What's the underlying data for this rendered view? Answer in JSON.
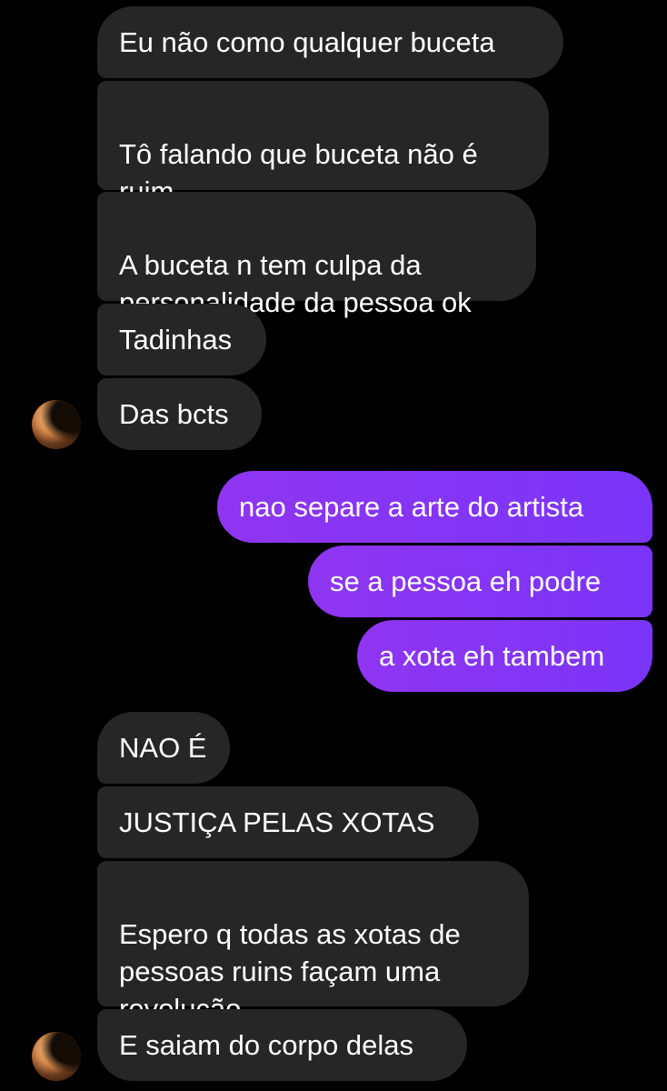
{
  "conversation": {
    "received_1": [
      "Eu não como qualquer buceta",
      "Tô falando que buceta não é\nruim",
      "A buceta n tem culpa da\npersonalidade da pessoa ok",
      "Tadinhas",
      "Das bcts"
    ],
    "sent": [
      "nao separe a arte do artista",
      "se a pessoa eh podre",
      "a xota eh tambem"
    ],
    "received_2": [
      "NAO É",
      "JUSTIÇA PELAS XOTAS",
      "Espero q todas as xotas de\npessoas ruins façam uma\nrevolução",
      "E saiam do corpo delas"
    ]
  },
  "avatar": {
    "icon": "contact-avatar-photo"
  },
  "colors": {
    "background": "#000000",
    "received_bubble": "#262626",
    "sent_bubble_start": "#8f35f1",
    "sent_bubble_end": "#7a35f9",
    "text": "#ffffff"
  }
}
